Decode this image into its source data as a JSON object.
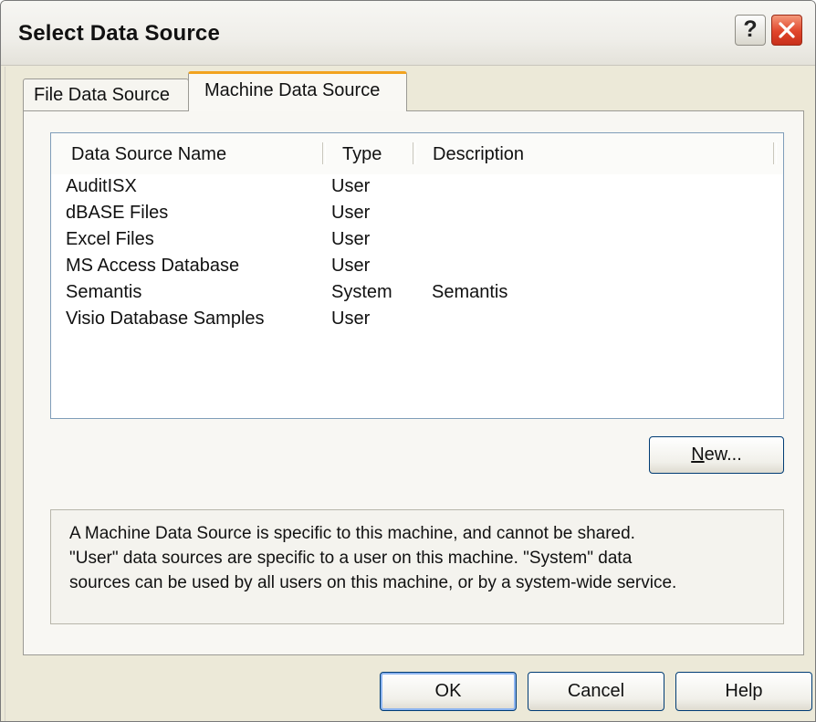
{
  "window": {
    "title": "Select Data Source",
    "help_glyph": "?",
    "close_icon": "close-icon"
  },
  "tabs": [
    {
      "label": "File Data Source",
      "selected": false
    },
    {
      "label": "Machine Data Source",
      "selected": true
    }
  ],
  "list": {
    "columns": [
      "Data Source Name",
      "Type",
      "Description"
    ],
    "rows": [
      {
        "name": "AuditISX",
        "type": "User",
        "description": ""
      },
      {
        "name": "dBASE Files",
        "type": "User",
        "description": ""
      },
      {
        "name": "Excel Files",
        "type": "User",
        "description": ""
      },
      {
        "name": "MS Access Database",
        "type": "User",
        "description": ""
      },
      {
        "name": "Semantis",
        "type": "System",
        "description": "Semantis"
      },
      {
        "name": "Visio Database Samples",
        "type": "User",
        "description": ""
      }
    ]
  },
  "buttons": {
    "new": {
      "mnemonic": "N",
      "rest": "ew..."
    },
    "ok": "OK",
    "cancel": "Cancel",
    "help": "Help"
  },
  "info": {
    "line1": "A Machine Data Source is specific to this machine, and cannot be shared.",
    "line2": "\"User\" data sources are specific to a user on this machine.  \"System\" data",
    "line3": "sources can be used by all users on this machine, or by a system-wide service."
  },
  "colors": {
    "dialog_bg": "#ece9d8",
    "tab_accent": "#f2a31f",
    "close_red": "#e0452b",
    "button_border": "#003c74"
  }
}
